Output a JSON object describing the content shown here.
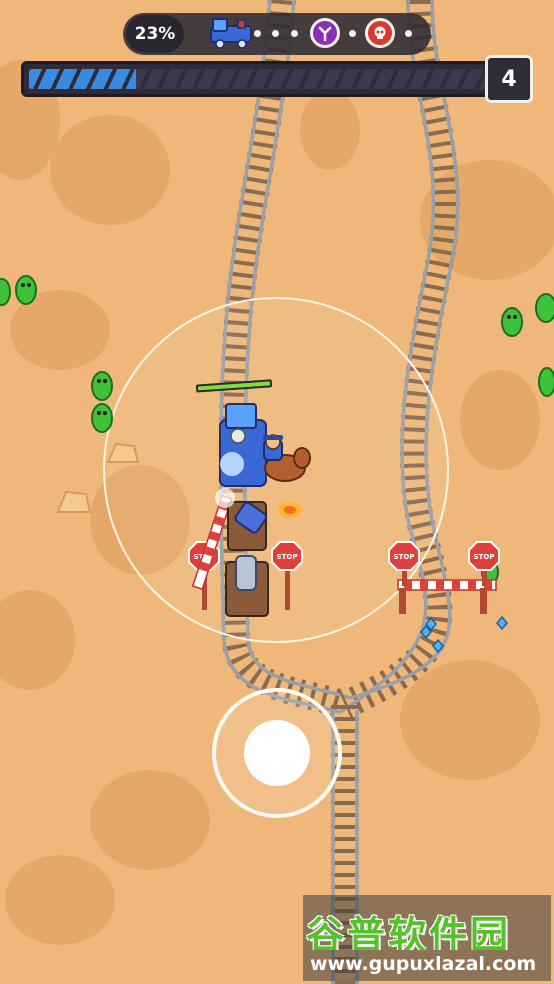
{
  "hud": {
    "progress_percent": "23%",
    "progress_fraction": 0.23,
    "waypoints": [
      "train-icon",
      "dot",
      "dot",
      "dot",
      "crossroads-icon",
      "dot",
      "skull-icon",
      "dot"
    ],
    "level": "4"
  },
  "signs": {
    "stop_label": "STOP"
  },
  "watermark": {
    "title": "谷普软件园",
    "url": "www.gupuxlazal.com"
  },
  "colors": {
    "sand": "#efb87a",
    "sand_dark": "#e6a866",
    "progress_blue": "#3a8be0",
    "zombie_green": "#3fc23a",
    "stop_red": "#e0403b",
    "purple_icon": "#8a2fb8",
    "skull_red": "#d8382f"
  }
}
